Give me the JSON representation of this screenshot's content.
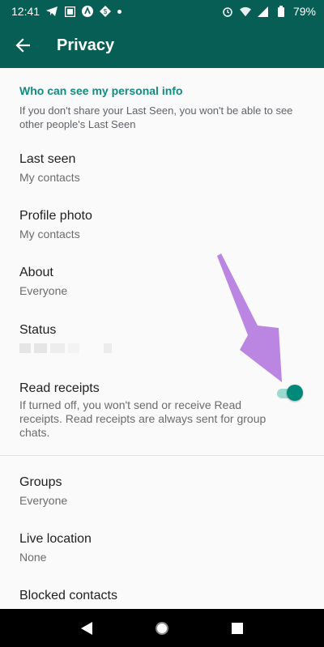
{
  "status_bar": {
    "time": "12:41",
    "battery": "79%",
    "icons_left": [
      "telegram-icon",
      "photos-icon",
      "assistant-icon",
      "app-icon",
      "dot-icon"
    ],
    "icons_right": [
      "alarm-icon",
      "wifi-icon",
      "signal-icon",
      "battery-icon"
    ]
  },
  "app_bar": {
    "title": "Privacy",
    "back_icon": "arrow-back-icon",
    "background": "#075e54"
  },
  "personal_info": {
    "header": "Who can see my personal info",
    "note": "If you don't share your Last Seen, you won't be able to see other people's Last Seen"
  },
  "items": {
    "last_seen": {
      "title": "Last seen",
      "value": "My contacts"
    },
    "profile_photo": {
      "title": "Profile photo",
      "value": "My contacts"
    },
    "about": {
      "title": "About",
      "value": "Everyone"
    },
    "status": {
      "title": "Status"
    },
    "read_receipts": {
      "title": "Read receipts",
      "description": "If turned off, you won't send or receive Read receipts. Read receipts are always sent for group chats.",
      "enabled": true
    },
    "groups": {
      "title": "Groups",
      "value": "Everyone"
    },
    "live_location": {
      "title": "Live location",
      "value": "None"
    },
    "blocked_contacts": {
      "title": "Blocked contacts"
    }
  },
  "colors": {
    "accent": "#128c7e",
    "toggle_on": "#00897b",
    "annotation_arrow": "#b57be0"
  },
  "nav_bar": {
    "icons": [
      "back-triangle-icon",
      "home-circle-icon",
      "recents-square-icon"
    ]
  }
}
